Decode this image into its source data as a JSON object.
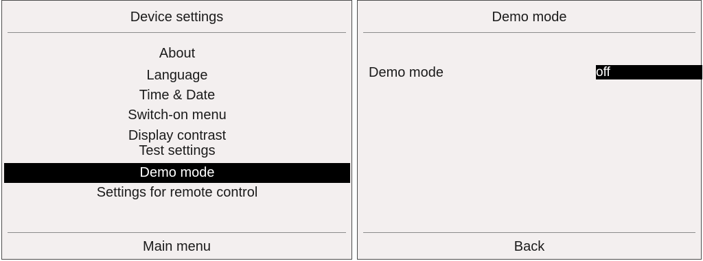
{
  "left_screen": {
    "title": "Device settings",
    "items": [
      {
        "label": "About"
      },
      {
        "label": "Language"
      },
      {
        "label": "Time & Date"
      },
      {
        "label": "Switch-on menu"
      },
      {
        "label": "Display contrast"
      },
      {
        "label": "Test settings"
      },
      {
        "label": "Demo mode",
        "selected": true
      },
      {
        "label": "Settings for remote control"
      }
    ],
    "footer": "Main menu"
  },
  "right_screen": {
    "title": "Demo mode",
    "setting": {
      "label": "Demo mode",
      "value": "off"
    },
    "footer": "Back"
  }
}
